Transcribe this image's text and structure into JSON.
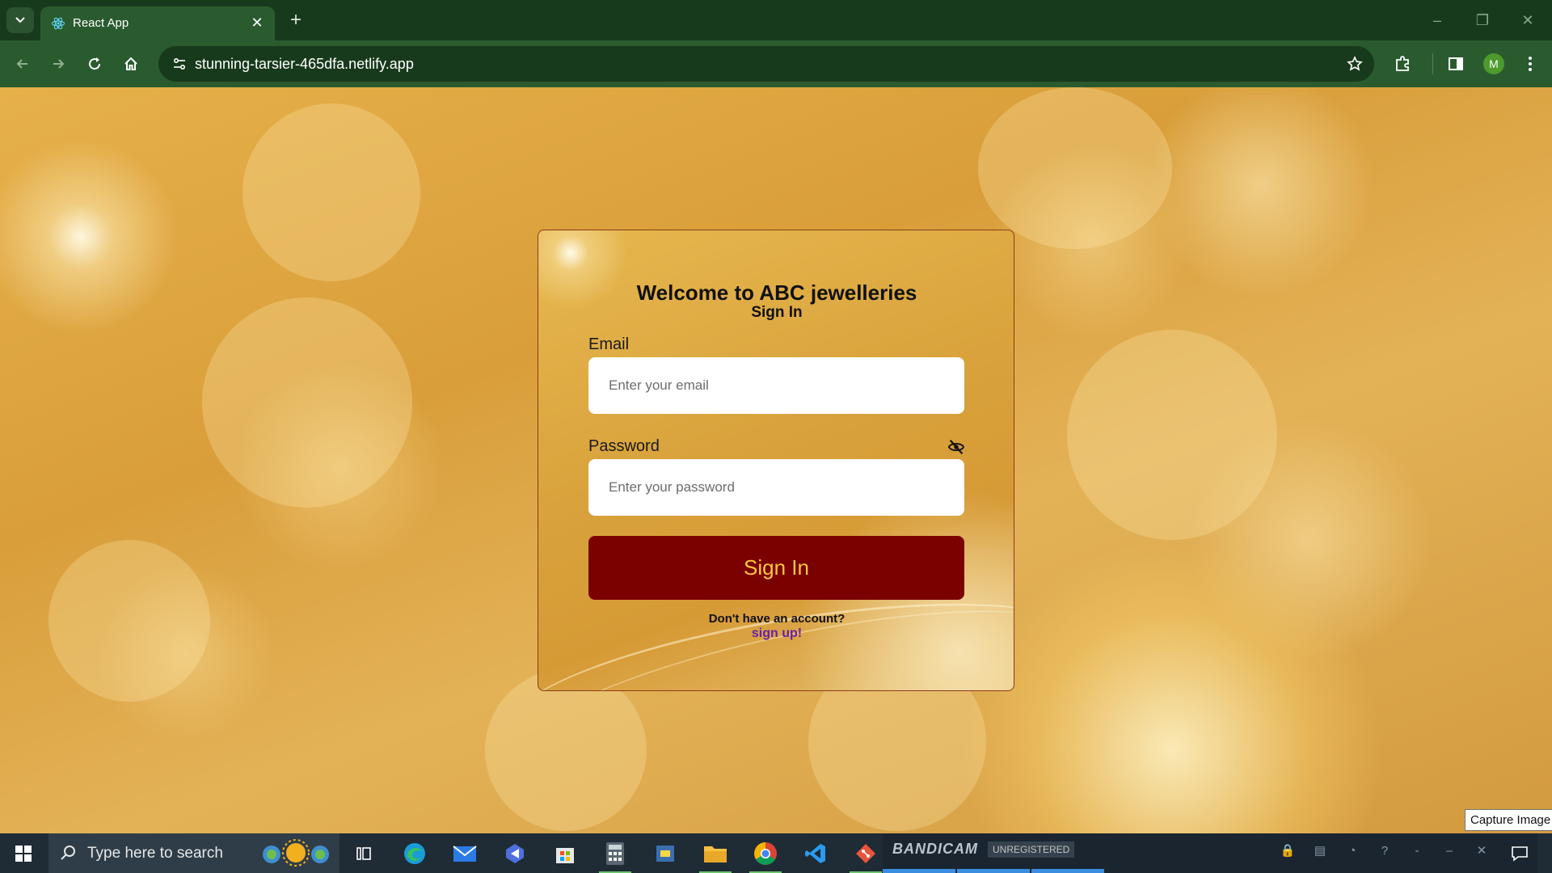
{
  "browser": {
    "tab_title": "React App",
    "url": "stunning-tarsier-465dfa.netlify.app",
    "profile_initial": "M"
  },
  "login": {
    "title": "Welcome to ABC jewelleries",
    "subtitle": "Sign In",
    "email_label": "Email",
    "email_placeholder": "Enter your email",
    "password_label": "Password",
    "password_placeholder": "Enter your password",
    "signin_button": "Sign In",
    "no_account_text": "Don't have an account?",
    "signup_link": "sign up!"
  },
  "taskbar": {
    "search_placeholder": "Type here to search",
    "bandicam_logo": "BANDICAM",
    "bandicam_status": "UNREGISTERED",
    "tooltip": "Capture Image"
  },
  "colors": {
    "chrome_dark": "#183a1c",
    "chrome_toolbar": "#2a5b2f",
    "button_bg": "#7b0000",
    "button_text": "#ffc83a",
    "signup_link": "#6a1fa6"
  }
}
